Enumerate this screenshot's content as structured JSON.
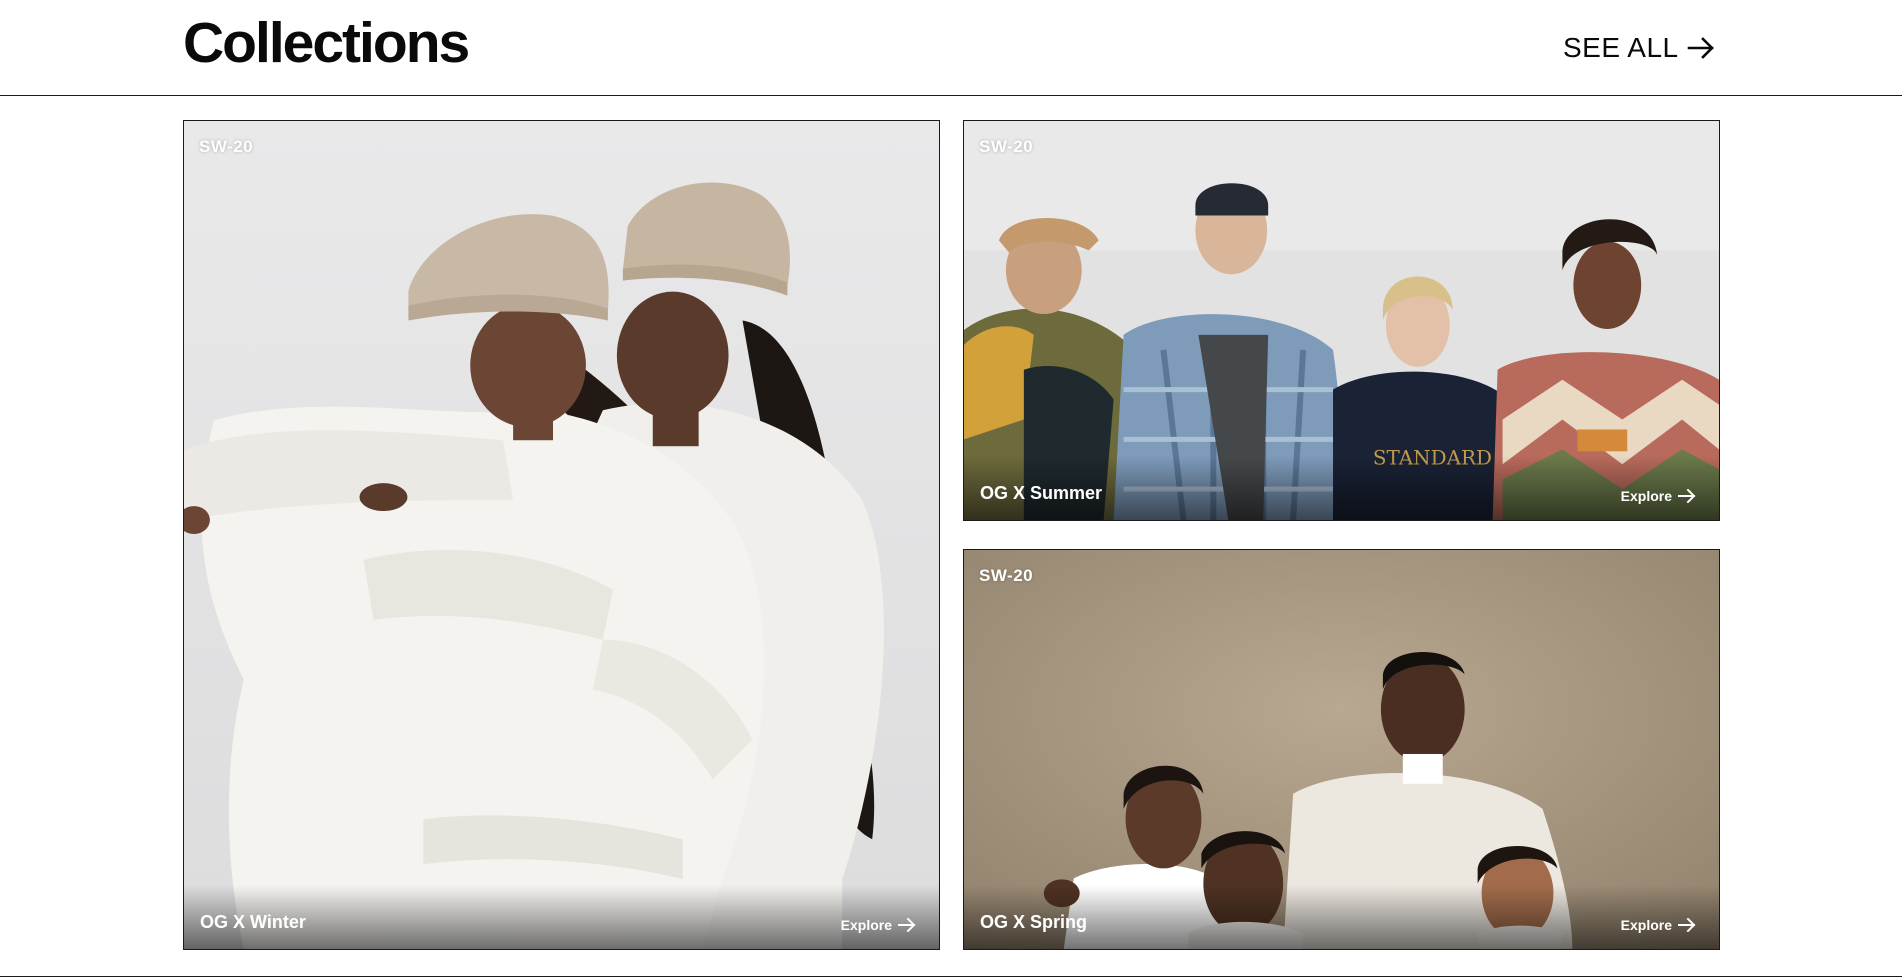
{
  "header": {
    "title": "Collections",
    "see_all_label": "SEE ALL",
    "see_all_icon": "arrow-right-icon"
  },
  "collections": [
    {
      "tag": "SW-20",
      "name": "OG X Winter",
      "explore_label": "Explore",
      "explore_icon": "arrow-right-icon"
    },
    {
      "tag": "SW-20",
      "name": "OG X Summer",
      "explore_label": "Explore",
      "explore_icon": "arrow-right-icon"
    },
    {
      "tag": "SW-20",
      "name": "OG X Spring",
      "explore_label": "Explore",
      "explore_icon": "arrow-right-icon"
    }
  ]
}
